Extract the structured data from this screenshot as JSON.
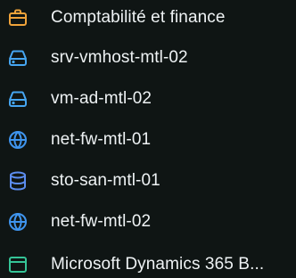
{
  "colors": {
    "background": "#0f1514",
    "text": "#eef2f4",
    "briefcase": "#f0a33a",
    "server": "#46a6f2",
    "globe": "#3f95ef",
    "database": "#5c8df0",
    "app": "#35c497"
  },
  "items": [
    {
      "label": "Comptabilité et finance",
      "icon": "briefcase-icon"
    },
    {
      "label": "srv-vmhost-mtl-02",
      "icon": "server-icon"
    },
    {
      "label": "vm-ad-mtl-02",
      "icon": "server-icon"
    },
    {
      "label": "net-fw-mtl-01",
      "icon": "globe-icon"
    },
    {
      "label": "sto-san-mtl-01",
      "icon": "database-icon"
    },
    {
      "label": "net-fw-mtl-02",
      "icon": "globe-icon"
    },
    {
      "label": "Microsoft Dynamics 365 B...",
      "icon": "app-window-icon"
    }
  ]
}
